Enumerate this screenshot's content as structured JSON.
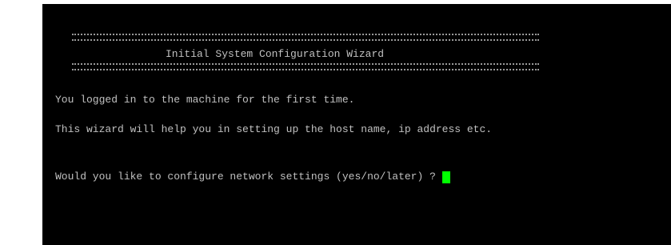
{
  "terminal": {
    "header_title": "Initial System Configuration Wizard",
    "line_first_login": "You logged in to the machine for the first time.",
    "line_wizard_help": "This wizard will help you in setting up the host name, ip address etc.",
    "prompt": "Would you like to configure network settings (yes/no/later) ?",
    "cursor_color": "#00ff00"
  }
}
